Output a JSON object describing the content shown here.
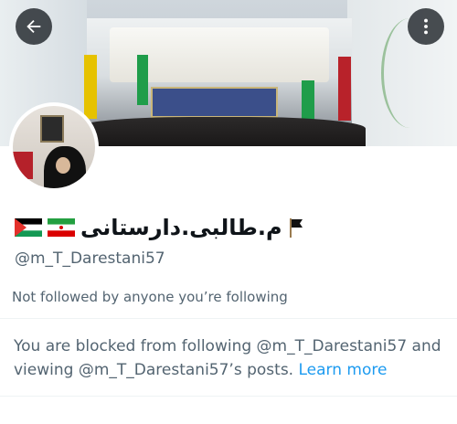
{
  "profile": {
    "display_name": "م.طالبی.دارستانی",
    "handle": "@m_T_Darestani57",
    "followed_by_text": "Not followed by anyone you’re following"
  },
  "blocked_notice": {
    "text": "You are blocked from following @m_T_Darestani57 and viewing @m_T_Darestani57’s posts.",
    "link_label": "Learn more"
  },
  "icons": {
    "back": "arrow-left-icon",
    "more": "more-vertical-icon",
    "flags": [
      "palestine-flag-icon",
      "iran-flag-icon",
      "black-flag-icon"
    ]
  },
  "colors": {
    "accent": "#1d9bf0",
    "secondary_text": "#536471",
    "primary_text": "#0f1419"
  }
}
